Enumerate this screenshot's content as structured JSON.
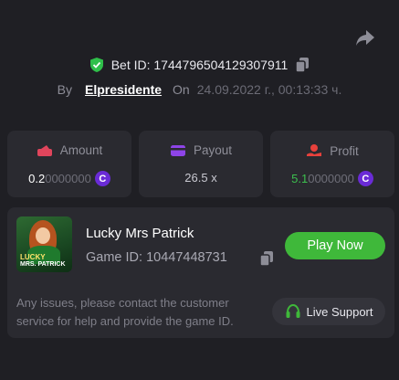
{
  "bet": {
    "label": "Bet ID: 1744796504129307911"
  },
  "author": {
    "by_label": "By",
    "username": "Elpresidente",
    "on_label": "On",
    "date": "24.09.2022 г., 00:13:33 ч."
  },
  "stats": {
    "amount": {
      "label": "Amount",
      "value_main": "0.2",
      "value_dim": "0000000",
      "coin_symbol": "C"
    },
    "payout": {
      "label": "Payout",
      "value": "26.5 x"
    },
    "profit": {
      "label": "Profit",
      "value_main": "5.1",
      "value_dim": "0000000",
      "coin_symbol": "C"
    }
  },
  "game": {
    "title": "Lucky Mrs Patrick",
    "id_label": "Game ID: 10447448731",
    "thumb_line1": "LUCKY",
    "thumb_line2": "MRS. PATRICK",
    "play_label": "Play Now"
  },
  "support": {
    "help_text": "Any issues, please contact the customer service for help and provide the game ID.",
    "button_label": "Live Support"
  },
  "colors": {
    "background": "#1f1f24",
    "card": "#2a2a30",
    "accent_green": "#3fb83a",
    "coin_purple": "#6a2bd6",
    "amount_icon": "#e0455c",
    "payout_icon": "#8e44e8",
    "profit_icon": "#e8413c"
  },
  "icons": [
    "share-icon",
    "shield-check-icon",
    "copy-icon",
    "amount-icon",
    "payout-icon",
    "profit-icon",
    "coin-icon",
    "headset-icon"
  ]
}
